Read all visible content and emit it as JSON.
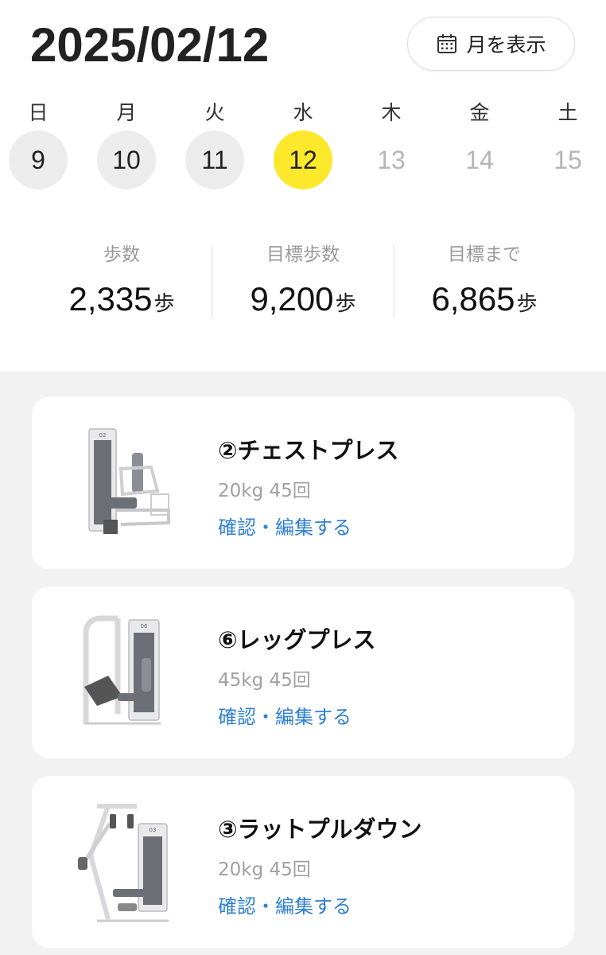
{
  "header": {
    "date": "2025/02/12",
    "month_button_label": "月を表示"
  },
  "week": {
    "days": [
      {
        "dow": "日",
        "date": "9",
        "state": "past"
      },
      {
        "dow": "月",
        "date": "10",
        "state": "past"
      },
      {
        "dow": "火",
        "date": "11",
        "state": "past"
      },
      {
        "dow": "水",
        "date": "12",
        "state": "today"
      },
      {
        "dow": "木",
        "date": "13",
        "state": "future"
      },
      {
        "dow": "金",
        "date": "14",
        "state": "future"
      },
      {
        "dow": "土",
        "date": "15",
        "state": "future"
      }
    ]
  },
  "stats": [
    {
      "label": "歩数",
      "value": "2,335",
      "unit": "歩"
    },
    {
      "label": "目標歩数",
      "value": "9,200",
      "unit": "歩"
    },
    {
      "label": "目標まで",
      "value": "6,865",
      "unit": "歩"
    }
  ],
  "exercises": [
    {
      "title": "②チェストプレス",
      "detail": "20kg 45回",
      "link": "確認・編集する",
      "machine_icon": "chest-press-machine",
      "machine_label": "02"
    },
    {
      "title": "⑥レッグプレス",
      "detail": "45kg 45回",
      "link": "確認・編集する",
      "machine_icon": "leg-press-machine",
      "machine_label": "06"
    },
    {
      "title": "③ラットプルダウン",
      "detail": "20kg 45回",
      "link": "確認・編集する",
      "machine_icon": "lat-pulldown-machine",
      "machine_label": "03"
    }
  ],
  "colors": {
    "today": "#fde82c",
    "past_day_bg": "#ececec",
    "link": "#2f7fd6",
    "background_cards": "#f2f2f2"
  }
}
